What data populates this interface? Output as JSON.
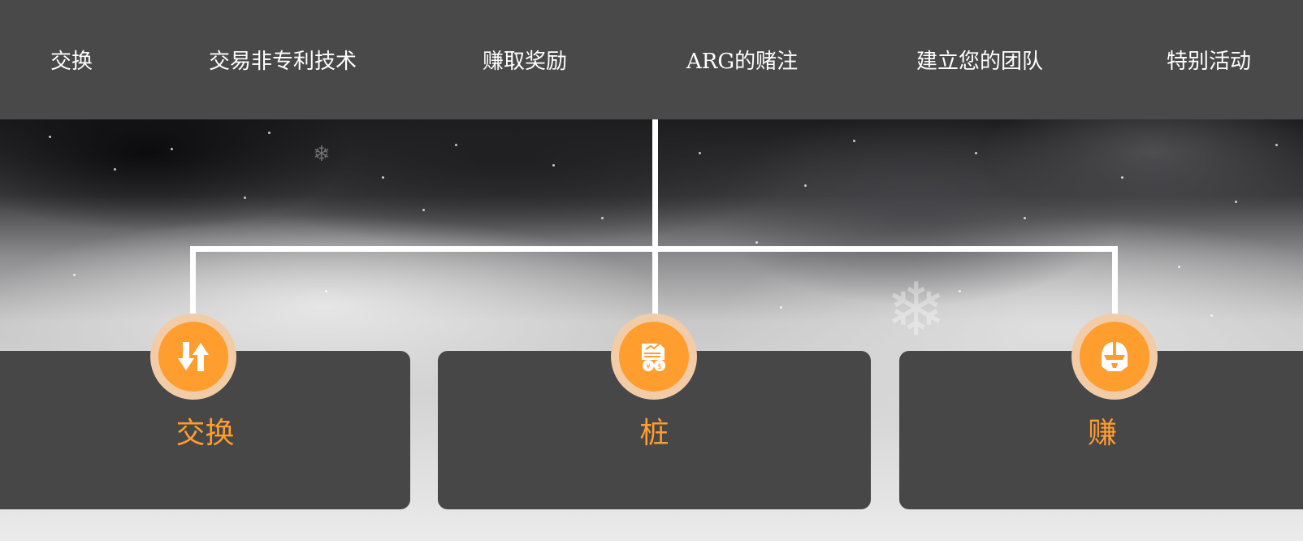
{
  "nav": {
    "items": [
      {
        "label": "交换"
      },
      {
        "label": "交易非专利技术"
      },
      {
        "label": "赚取奖励"
      },
      {
        "label": "ARG的赌注"
      },
      {
        "label": "建立您的团队"
      },
      {
        "label": "特别活动"
      }
    ]
  },
  "cards": [
    {
      "title": "交换",
      "icon": "swap-arrows-icon"
    },
    {
      "title": "桩",
      "icon": "stake-document-coins-icon"
    },
    {
      "title": "赚",
      "icon": "helmet-icon"
    }
  ],
  "colors": {
    "nav_background": "#494949",
    "card_background": "#474747",
    "accent": "#ff9d2e",
    "badge_ring": "#f2cca6",
    "connector": "#ffffff"
  }
}
